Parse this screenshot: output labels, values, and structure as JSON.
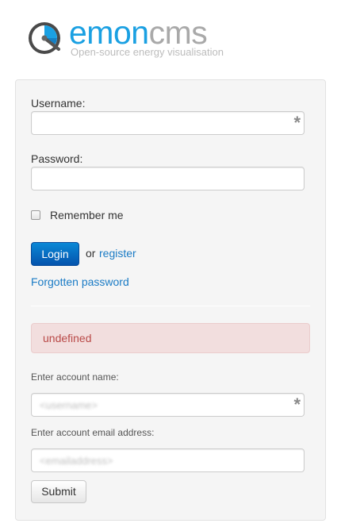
{
  "brand": {
    "name_part1": "emon",
    "name_part2": "cms",
    "tagline": "Open-source energy visualisation",
    "logo_icon": "gauge-icon",
    "colors": {
      "emon": "#1aa0e2",
      "cms": "#a9a9a9"
    }
  },
  "login": {
    "username_label": "Username:",
    "password_label": "Password:",
    "remember_label": "Remember me",
    "login_button": "Login",
    "or_text": "or",
    "register_link": "register",
    "forgot_link": "Forgotten password"
  },
  "alert": {
    "text": "undefined",
    "color": "#b94a48"
  },
  "reset": {
    "account_name_label": "Enter account name:",
    "account_name_placeholder": "<username>",
    "email_label": "Enter account email address:",
    "email_placeholder": "<emailaddress>",
    "submit_button": "Submit"
  },
  "icons": {
    "required": "asterisk-icon",
    "checkbox": "checkbox-icon"
  },
  "accent_color": "#0a70c8"
}
